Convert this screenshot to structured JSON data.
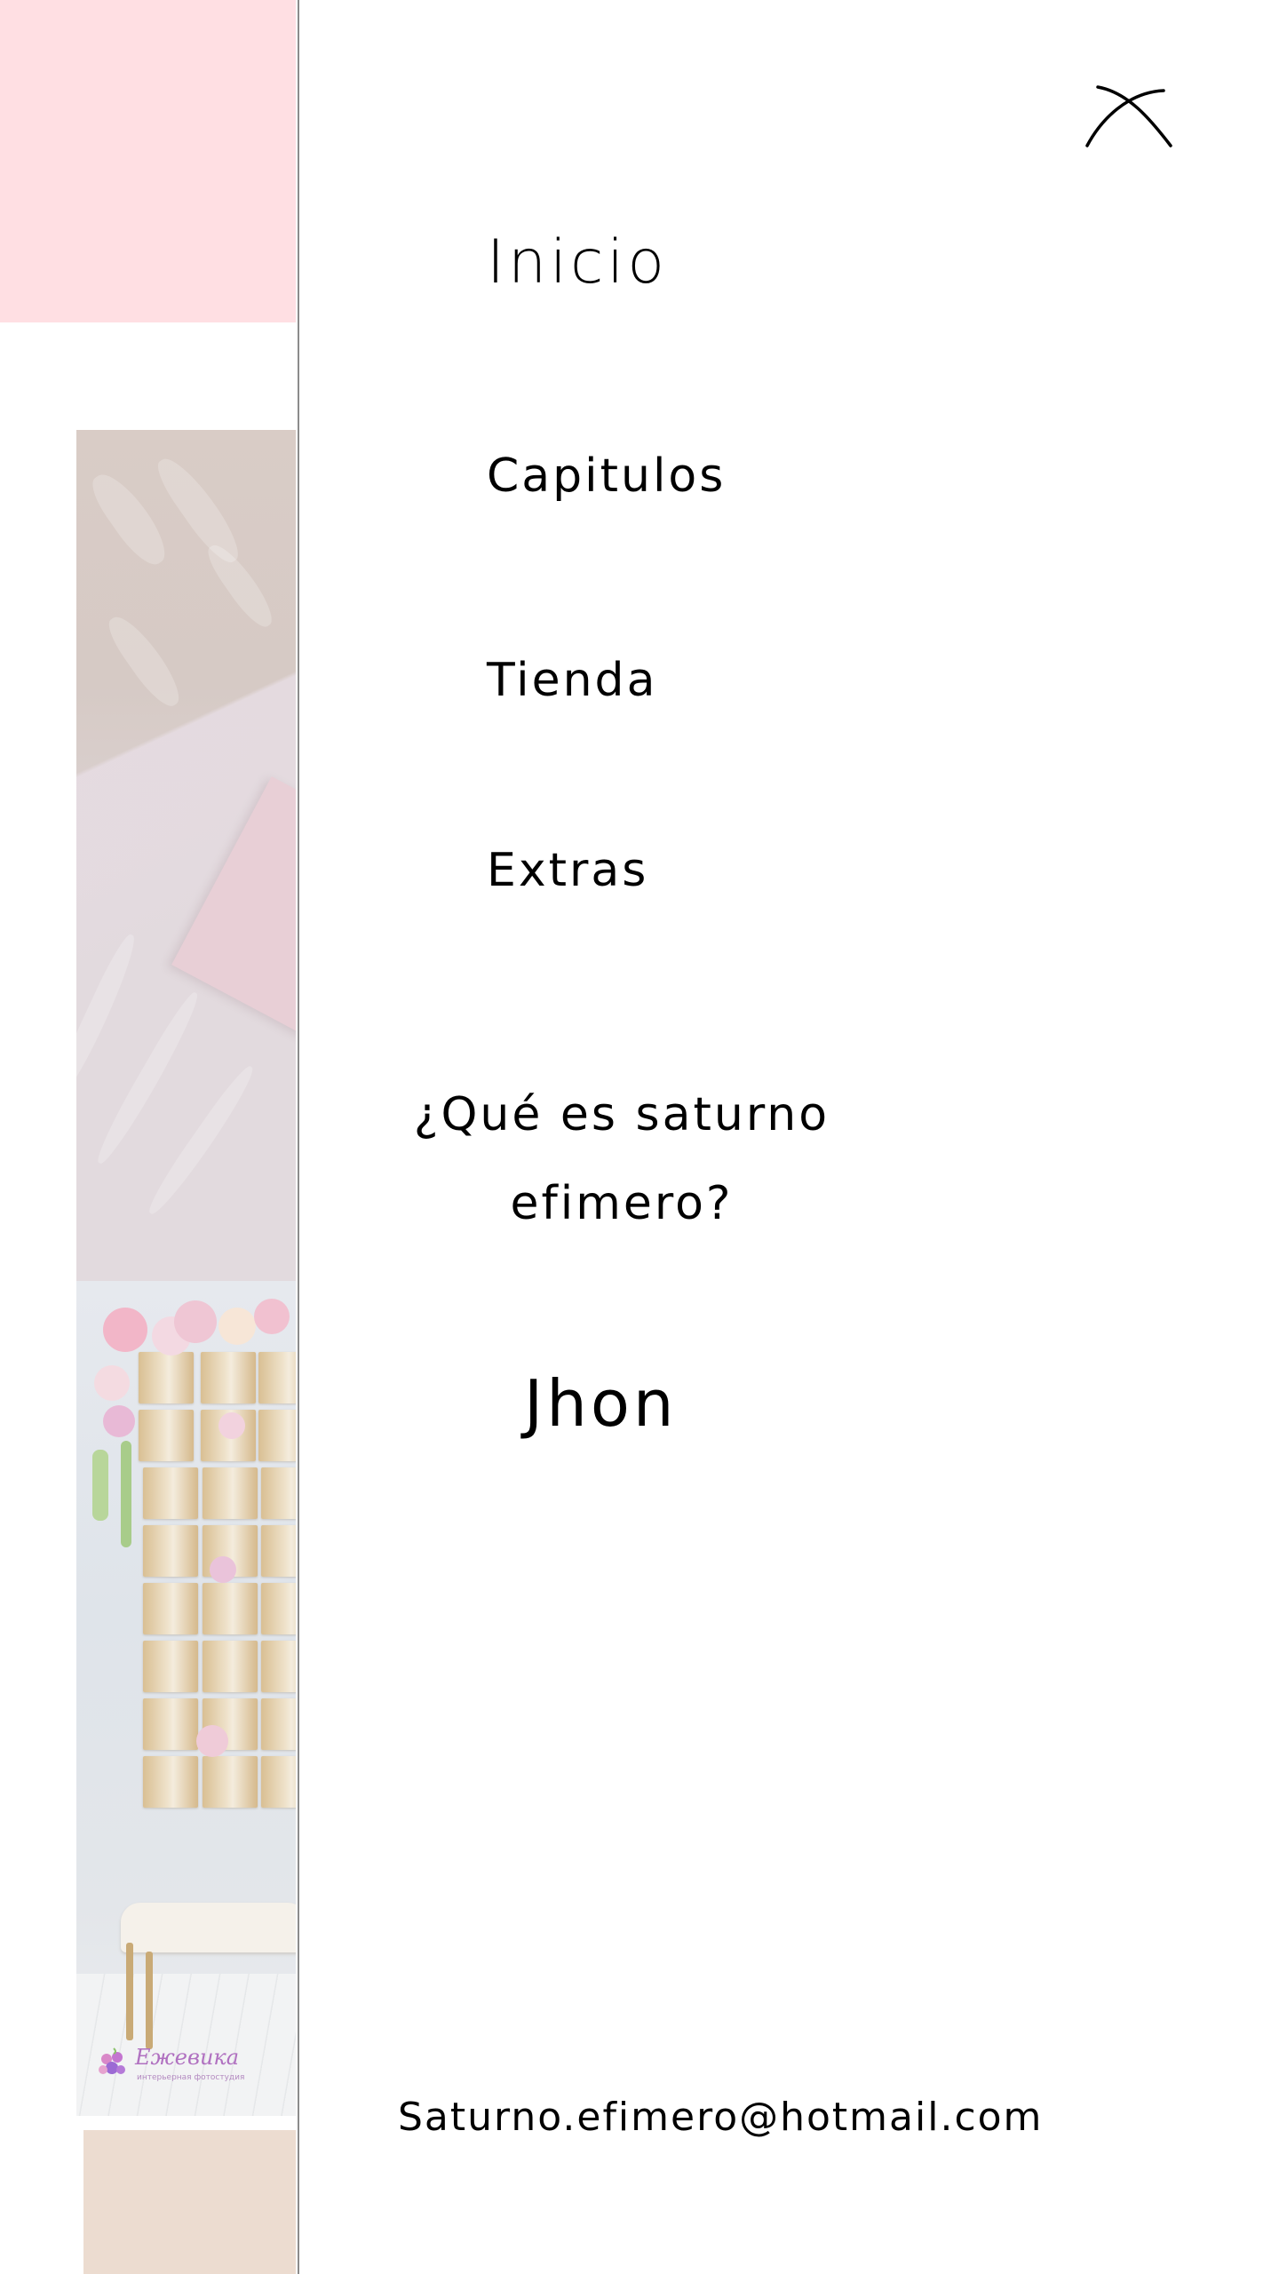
{
  "menu": {
    "close_icon": "close-icon",
    "items": [
      {
        "label": "Inicio"
      },
      {
        "label": "Capitulos"
      },
      {
        "label": "Tienda"
      },
      {
        "label": "Extras"
      },
      {
        "label": "¿Qué es saturno efimero?"
      },
      {
        "label": "Jhon"
      }
    ]
  },
  "contact": {
    "email": "Saturno.efimero@hotmail.com"
  },
  "background": {
    "watermark": {
      "brand": "Ежевика",
      "tagline": "интерьерная фотостудия"
    },
    "colors": {
      "pink_block": "#ffdfe3",
      "beige_block": "#ecdcd0"
    }
  }
}
